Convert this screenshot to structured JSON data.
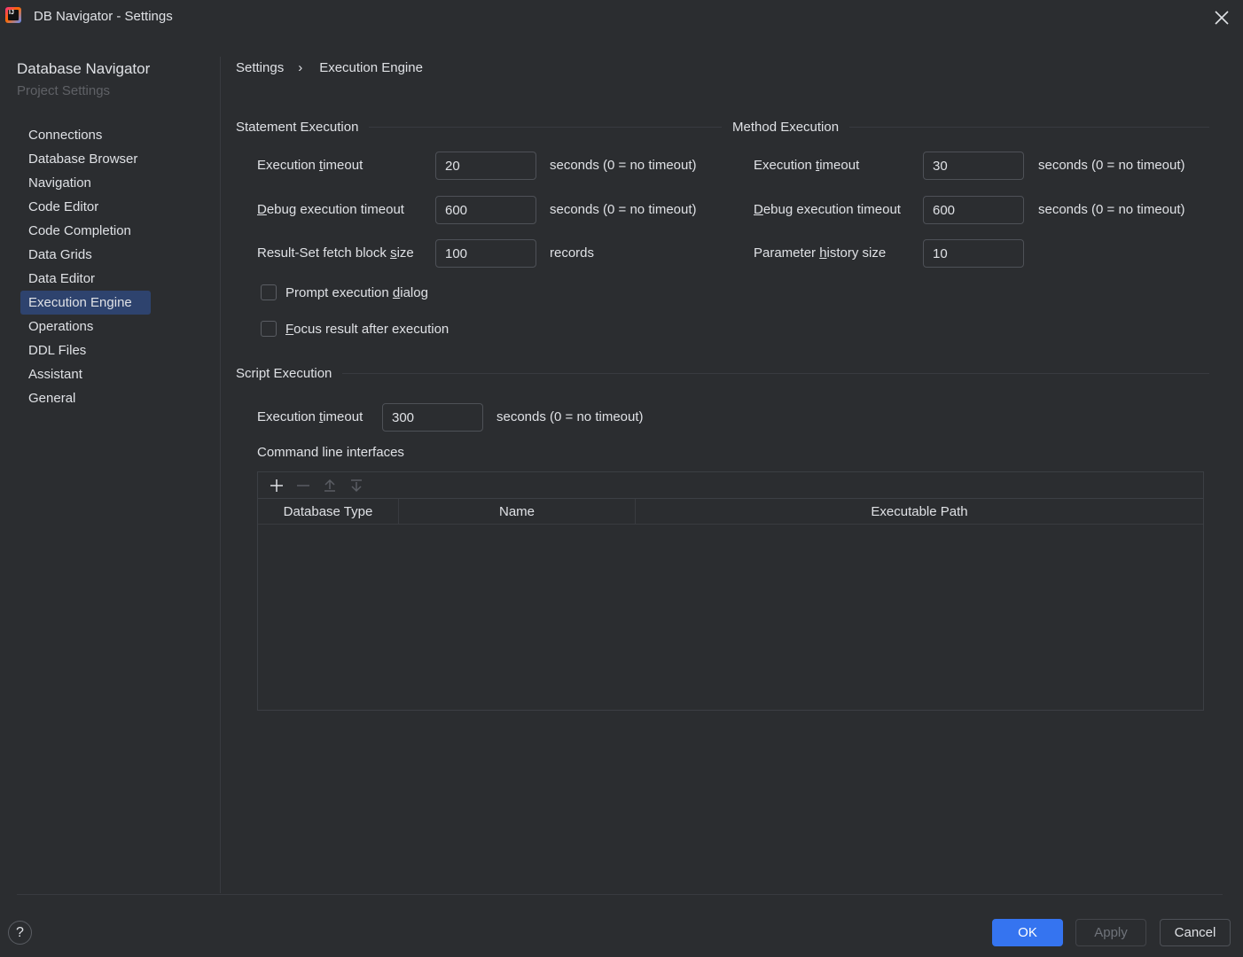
{
  "window": {
    "title": "DB Navigator - Settings",
    "app_icon_text": "IJ"
  },
  "sidebar": {
    "title": "Database Navigator",
    "subtitle": "Project Settings",
    "items": [
      {
        "label": "Connections"
      },
      {
        "label": "Database Browser"
      },
      {
        "label": "Navigation"
      },
      {
        "label": "Code Editor"
      },
      {
        "label": "Code Completion"
      },
      {
        "label": "Data Grids"
      },
      {
        "label": "Data Editor"
      },
      {
        "label": "Execution Engine",
        "selected": true
      },
      {
        "label": "Operations"
      },
      {
        "label": "DDL Files"
      },
      {
        "label": "Assistant"
      },
      {
        "label": "General"
      }
    ]
  },
  "breadcrumb": {
    "parent": "Settings",
    "separator": "›",
    "current": "Execution Engine"
  },
  "statement": {
    "title": "Statement Execution",
    "execution_timeout": {
      "label_pre": "Execution ",
      "label_u": "t",
      "label_post": "imeout",
      "value": "20",
      "unit": "seconds (0 = no timeout)"
    },
    "debug_timeout": {
      "label_pre": "",
      "label_u": "D",
      "label_post": "ebug execution timeout",
      "value": "600",
      "unit": "seconds (0 = no timeout)"
    },
    "fetch_block": {
      "label_pre": "Result-Set fetch block ",
      "label_u": "s",
      "label_post": "ize",
      "value": "100",
      "unit": "records"
    },
    "prompt_dialog": {
      "label_pre": "Prompt execution ",
      "label_u": "d",
      "label_post": "ialog",
      "checked": false
    },
    "focus_result": {
      "label_pre": "",
      "label_u": "F",
      "label_post": "ocus result after execution",
      "checked": false
    }
  },
  "method": {
    "title": "Method Execution",
    "execution_timeout": {
      "label_pre": "Execution ",
      "label_u": "t",
      "label_post": "imeout",
      "value": "30",
      "unit": "seconds (0 = no timeout)"
    },
    "debug_timeout": {
      "label_pre": "",
      "label_u": "D",
      "label_post": "ebug execution timeout",
      "value": "600",
      "unit": "seconds (0 = no timeout)"
    },
    "param_history": {
      "label_pre": "Parameter ",
      "label_u": "h",
      "label_post": "istory size",
      "value": "10"
    }
  },
  "script": {
    "title": "Script Execution",
    "execution_timeout": {
      "label_pre": "Execution ",
      "label_u": "t",
      "label_post": "imeout",
      "value": "300",
      "unit": "seconds (0 = no timeout)"
    },
    "cli_label": "Command line interfaces",
    "toolbar": {
      "add_icon": "plus-icon",
      "remove_icon": "minus-icon",
      "up_icon": "move-up-icon",
      "down_icon": "move-down-icon"
    },
    "columns": [
      "Database Type",
      "Name",
      "Executable Path"
    ],
    "rows": []
  },
  "buttons": {
    "ok": "OK",
    "apply": "Apply",
    "cancel": "Cancel",
    "help": "?"
  },
  "colors": {
    "accent": "#3574f0",
    "selection": "#2e436e",
    "background": "#2b2d30"
  }
}
